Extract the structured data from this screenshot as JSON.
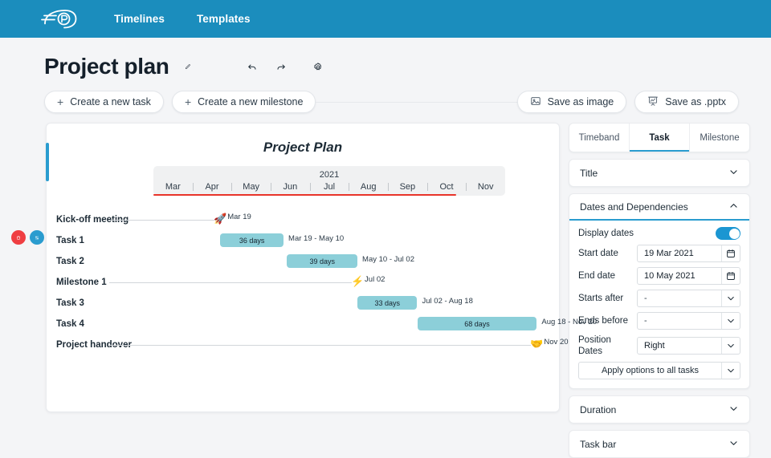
{
  "topbar": {
    "logo_name": "preceden-logo",
    "nav": [
      {
        "label": "Timelines"
      },
      {
        "label": "Templates"
      }
    ]
  },
  "header": {
    "title": "Project plan",
    "edit_icon": "pencil-icon",
    "undo_icon": "undo-arrow-icon",
    "redo_icon": "redo-arrow-icon",
    "settings_icon": "gear-icon"
  },
  "actions": {
    "create_task": "Create a new task",
    "create_milestone": "Create a new milestone",
    "save_image": "Save as image",
    "save_pptx": "Save as .pptx",
    "plus": "+"
  },
  "float_buttons": {
    "delete": "delete-row-button",
    "reorder": "reorder-row-button"
  },
  "chart": {
    "title": "Project Plan",
    "timeband": {
      "year": "2021",
      "months": [
        "Mar",
        "Apr",
        "May",
        "Jun",
        "Jul",
        "Aug",
        "Sep",
        "Oct",
        "Nov"
      ],
      "highlight_color": "#e8342a",
      "highlight_start_pct": 0,
      "highlight_end_pct": 86
    },
    "bar_color": "#8ccfd9",
    "rows": [
      {
        "label": "Kick-off meeting",
        "type": "milestone",
        "icon": "rocket-icon",
        "glyph": "🚀",
        "date": "Mar 19",
        "pos_pct": 19
      },
      {
        "label": "Task 1",
        "type": "task",
        "duration": "36 days",
        "date": "Mar 19 - May 10",
        "start_pct": 19,
        "end_pct": 37,
        "selected": true
      },
      {
        "label": "Task 2",
        "type": "task",
        "duration": "39 days",
        "date": "May 10 - Jul 02",
        "start_pct": 38,
        "end_pct": 58
      },
      {
        "label": "Milestone 1",
        "type": "milestone",
        "icon": "lightning-icon",
        "glyph": "⚡",
        "date": "Jul 02",
        "pos_pct": 58
      },
      {
        "label": "Task 3",
        "type": "task",
        "duration": "33 days",
        "date": "Jul 02 - Aug 18",
        "start_pct": 58,
        "end_pct": 75
      },
      {
        "label": "Task 4",
        "type": "task",
        "duration": "68 days",
        "date": "Aug 18 - Nov 20",
        "start_pct": 75,
        "end_pct": 109
      },
      {
        "label": "Project handover",
        "type": "milestone",
        "icon": "handover-icon",
        "glyph": "🤝",
        "date": "Nov 20",
        "pos_pct": 109
      }
    ]
  },
  "panel": {
    "tabs": [
      {
        "label": "Timeband",
        "active": false
      },
      {
        "label": "Task",
        "active": true
      },
      {
        "label": "Milestone",
        "active": false
      }
    ],
    "accent_color": "#2a9ccf",
    "sections": {
      "title": {
        "label": "Title",
        "open": false
      },
      "dates": {
        "label": "Dates and Dependencies",
        "open": true,
        "display_dates_label": "Display dates",
        "display_dates_on": true,
        "start_date_label": "Start date",
        "start_date_value": "19 Mar 2021",
        "end_date_label": "End date",
        "end_date_value": "10 May 2021",
        "starts_after_label": "Starts after",
        "starts_after_value": "-",
        "ends_before_label": "Ends before",
        "ends_before_value": "-",
        "position_dates_label": "Position Dates",
        "position_dates_value": "Right",
        "apply_all_label": "Apply options to all tasks",
        "calendar_icon": "calendar-icon",
        "chevron_icon": "chevron-down-icon"
      },
      "duration": {
        "label": "Duration",
        "open": false
      },
      "taskbar": {
        "label": "Task bar",
        "open": false
      }
    }
  }
}
